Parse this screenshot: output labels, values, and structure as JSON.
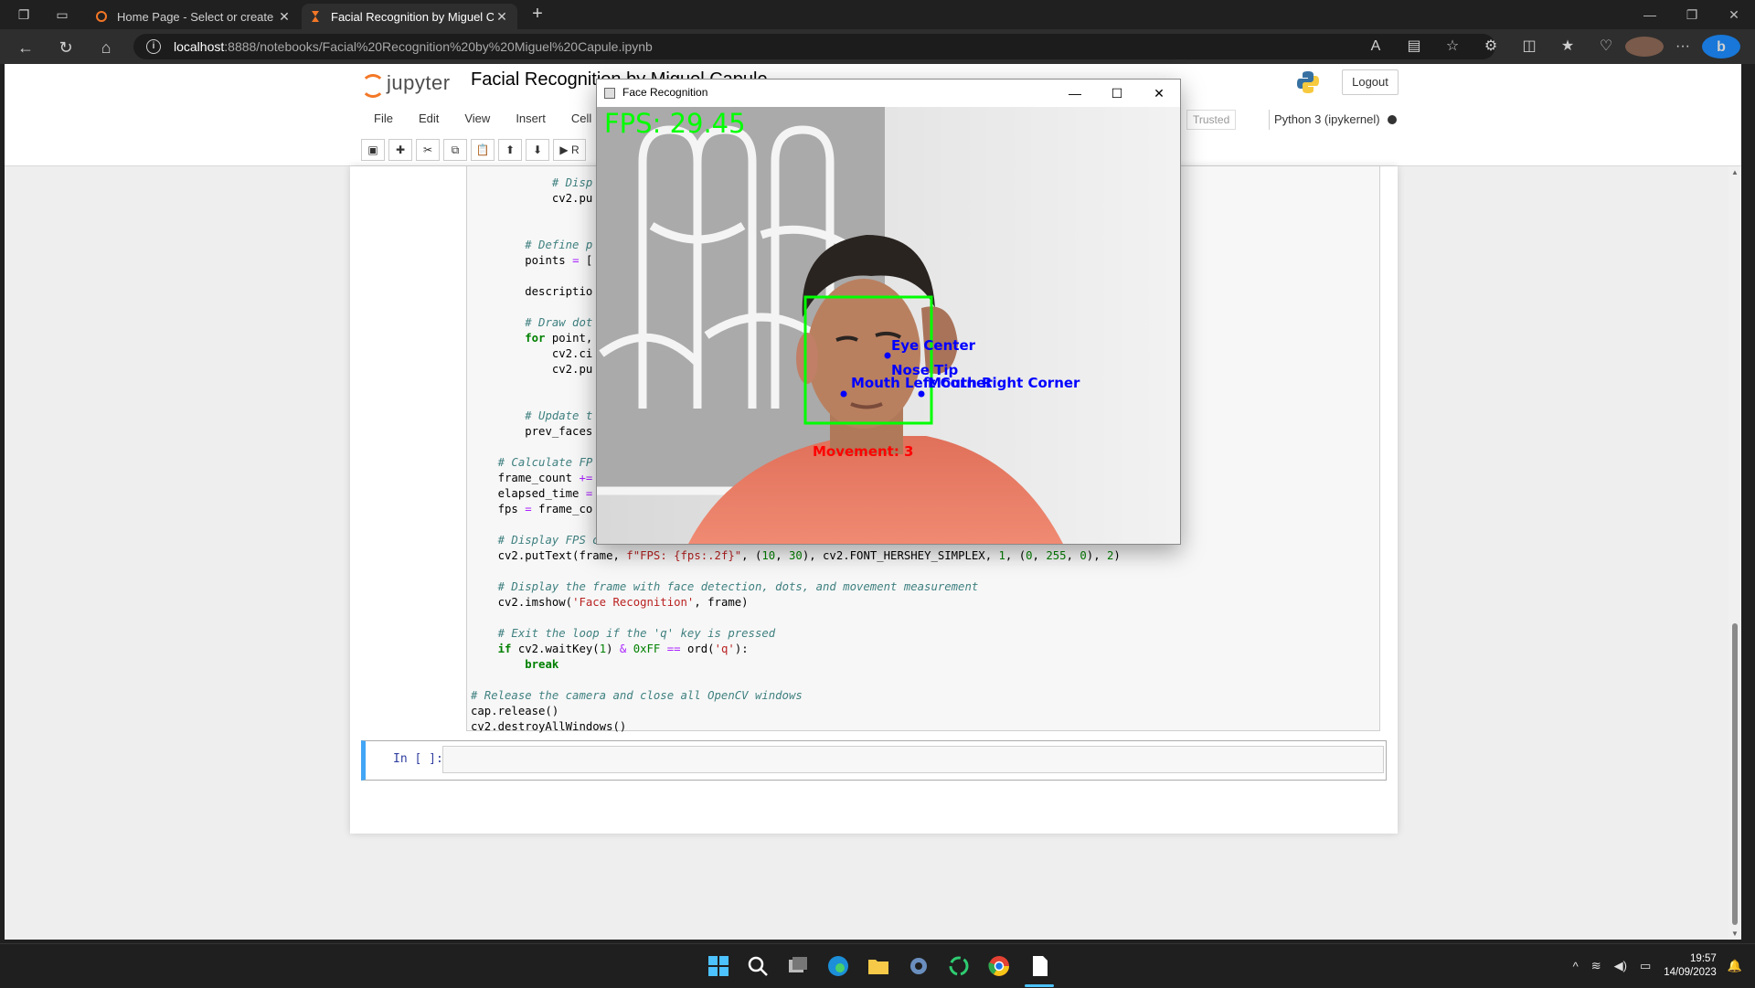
{
  "browser": {
    "tabs": [
      {
        "title": "Home Page - Select or create a n",
        "active": false
      },
      {
        "title": "Facial Recognition by Miguel Cap",
        "active": true
      }
    ],
    "url_host": "localhost",
    "url_path": ":8888/notebooks/Facial%20Recognition%20by%20Miguel%20Capule.ipynb"
  },
  "jupyter": {
    "logo_text": "jupyter",
    "notebook_title": "Facial Recognition by Miguel Capule",
    "logout_label": "Logout",
    "menu": [
      "File",
      "Edit",
      "View",
      "Insert",
      "Cell"
    ],
    "trusted_label": "Trusted",
    "kernel_label": "Python 3 (ipykernel)",
    "run_label": "R",
    "empty_cell_prompt": "In [ ]:"
  },
  "code_lines": [
    {
      "indent": 12,
      "parts": [
        [
          "c",
          "# Disp"
        ]
      ]
    },
    {
      "indent": 12,
      "parts": [
        [
          "t",
          "cv2.pu"
        ]
      ]
    },
    {
      "indent": 0,
      "parts": []
    },
    {
      "indent": 0,
      "parts": []
    },
    {
      "indent": 8,
      "parts": [
        [
          "c",
          "# Define p"
        ]
      ]
    },
    {
      "indent": 8,
      "parts": [
        [
          "t",
          "points "
        ],
        [
          "o",
          "="
        ],
        [
          "t",
          " ["
        ]
      ]
    },
    {
      "indent": 0,
      "parts": []
    },
    {
      "indent": 8,
      "parts": [
        [
          "t",
          "descriptio"
        ]
      ]
    },
    {
      "indent": 0,
      "parts": []
    },
    {
      "indent": 8,
      "parts": [
        [
          "c",
          "# Draw dot"
        ]
      ]
    },
    {
      "indent": 8,
      "parts": [
        [
          "k",
          "for"
        ],
        [
          "t",
          " point,"
        ]
      ]
    },
    {
      "indent": 12,
      "parts": [
        [
          "t",
          "cv2.ci"
        ]
      ]
    },
    {
      "indent": 12,
      "parts": [
        [
          "t",
          "cv2.pu"
        ]
      ]
    },
    {
      "indent": 0,
      "parts": []
    },
    {
      "indent": 0,
      "parts": []
    },
    {
      "indent": 8,
      "parts": [
        [
          "c",
          "# Update t"
        ]
      ]
    },
    {
      "indent": 8,
      "parts": [
        [
          "t",
          "prev_faces"
        ]
      ]
    },
    {
      "indent": 0,
      "parts": []
    },
    {
      "indent": 4,
      "parts": [
        [
          "c",
          "# Calculate FP"
        ]
      ]
    },
    {
      "indent": 4,
      "parts": [
        [
          "t",
          "frame_count "
        ],
        [
          "o",
          "+="
        ]
      ]
    },
    {
      "indent": 4,
      "parts": [
        [
          "t",
          "elapsed_time "
        ],
        [
          "o",
          "="
        ]
      ]
    },
    {
      "indent": 4,
      "parts": [
        [
          "t",
          "fps "
        ],
        [
          "o",
          "="
        ],
        [
          "t",
          " frame_co"
        ]
      ]
    },
    {
      "indent": 0,
      "parts": []
    },
    {
      "indent": 4,
      "parts": [
        [
          "c",
          "# Display FPS on the frame"
        ]
      ]
    },
    {
      "indent": 4,
      "parts": [
        [
          "t",
          "cv2.putText(frame, "
        ],
        [
          "s",
          "f\"FPS: {fps:.2f}\""
        ],
        [
          "t",
          ", ("
        ],
        [
          "n",
          "10"
        ],
        [
          "t",
          ", "
        ],
        [
          "n",
          "30"
        ],
        [
          "t",
          "), cv2.FONT_HERSHEY_SIMPLEX, "
        ],
        [
          "n",
          "1"
        ],
        [
          "t",
          ", ("
        ],
        [
          "n",
          "0"
        ],
        [
          "t",
          ", "
        ],
        [
          "n",
          "255"
        ],
        [
          "t",
          ", "
        ],
        [
          "n",
          "0"
        ],
        [
          "t",
          "), "
        ],
        [
          "n",
          "2"
        ],
        [
          "t",
          ")"
        ]
      ]
    },
    {
      "indent": 0,
      "parts": []
    },
    {
      "indent": 4,
      "parts": [
        [
          "c",
          "# Display the frame with face detection, dots, and movement measurement"
        ]
      ]
    },
    {
      "indent": 4,
      "parts": [
        [
          "t",
          "cv2.imshow("
        ],
        [
          "s",
          "'Face Recognition'"
        ],
        [
          "t",
          ", frame)"
        ]
      ]
    },
    {
      "indent": 0,
      "parts": []
    },
    {
      "indent": 4,
      "parts": [
        [
          "c",
          "# Exit the loop if the 'q' key is pressed"
        ]
      ]
    },
    {
      "indent": 4,
      "parts": [
        [
          "k",
          "if"
        ],
        [
          "t",
          " cv2.waitKey("
        ],
        [
          "n",
          "1"
        ],
        [
          "t",
          ") "
        ],
        [
          "o",
          "&"
        ],
        [
          "t",
          " "
        ],
        [
          "n",
          "0xFF"
        ],
        [
          "t",
          " "
        ],
        [
          "o",
          "=="
        ],
        [
          "t",
          " ord("
        ],
        [
          "s",
          "'q'"
        ],
        [
          "t",
          "):"
        ]
      ]
    },
    {
      "indent": 8,
      "parts": [
        [
          "k",
          "break"
        ]
      ]
    },
    {
      "indent": 0,
      "parts": []
    },
    {
      "indent": 0,
      "parts": [
        [
          "c",
          "# Release the camera and close all OpenCV windows"
        ]
      ]
    },
    {
      "indent": 0,
      "parts": [
        [
          "t",
          "cap.release()"
        ]
      ]
    },
    {
      "indent": 0,
      "parts": [
        [
          "t",
          "cv2.destroyAllWindows()"
        ]
      ]
    }
  ],
  "cv_window": {
    "title": "Face Recognition",
    "fps_text": "FPS: 29.45",
    "labels": {
      "eye_center": "Eye Center",
      "nose_tip": "Nose Tip",
      "mouth_left": "Mouth Left Corner",
      "mouth_right": "Mouth Right Corner",
      "movement": "Movement: 3"
    },
    "colors": {
      "box": "#00ff00",
      "labels": "#0000ff",
      "movement": "#ff0000",
      "fps": "#00ff00"
    }
  },
  "taskbar": {
    "time": "19:57",
    "date": "14/09/2023",
    "apps": [
      "start-icon",
      "search-icon",
      "task-view-icon",
      "edge-icon",
      "file-explorer-icon",
      "settings-icon",
      "jupyter-icon",
      "chrome-icon",
      "notepad-icon"
    ]
  }
}
